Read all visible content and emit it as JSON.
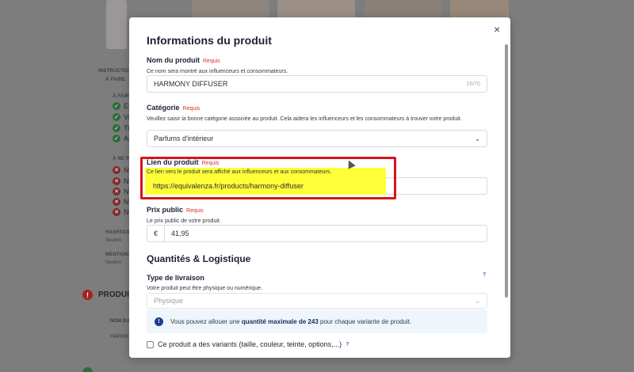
{
  "background": {
    "instructions_label": "INSTRUCTIO",
    "a_faire_label": "À FAIRE",
    "a_faire_sub": "À FAIRE",
    "do_items": [
      "Ex",
      "Vi",
      "Ti",
      "Ar"
    ],
    "ne_pas_label": "À NE P",
    "dont_items": [
      "N",
      "N",
      "N",
      "N",
      "N"
    ],
    "hashtags_label": "HASHTAG",
    "hashtags_value": "Seulem",
    "mentions_label": "MENTIONS",
    "mentions_value": "Seulem",
    "produit_heading": "PRODUIT",
    "nom_du_label": "NOM DU",
    "harmony_text": "HARMO"
  },
  "modal": {
    "title": "Informations du produit",
    "close": "×",
    "required": "Requis",
    "name": {
      "label": "Nom du produit",
      "help": "Ce nom sera montré aux influenceurs et consommateurs.",
      "value": "HARMONY DIFFUSER",
      "counter": "16/70"
    },
    "category": {
      "label": "Catégorie",
      "help": "Veuillez saisir la bonne catégorie associée au produit. Cela aidera les influenceurs et les consommateurs à trouver votre produit.",
      "value": "Parfums d'intérieur"
    },
    "link": {
      "label": "Lien du produit",
      "help": "Ce lien vers le produit sera affiché aux influenceurs et aux consommateurs.",
      "value": "https://equivalenza.fr/products/harmony-diffuser"
    },
    "price": {
      "label": "Prix public",
      "help": "Le prix public de votre produit.",
      "currency": "€",
      "value": "41,95"
    },
    "logistics": {
      "section_title": "Quantités & Logistique",
      "delivery_label": "Type de livraison",
      "delivery_help": "Votre produit peut être physique ou numérique.",
      "delivery_value": "Physique",
      "info_prefix": "Vous pouvez allouer une ",
      "info_bold": "quantité maximale de 243",
      "info_suffix": " pour chaque variante de produit.",
      "variants_label": "Ce produit a des variants (taille, couleur, teinte, options,...)"
    }
  },
  "icons": {
    "close": "close-icon",
    "chevron": "chevron-down-icon",
    "info": "info-icon",
    "help": "question-mark-icon"
  },
  "colors": {
    "required": "#e0302b",
    "highlight_box": "#d8141c",
    "highlight_fill": "#ffff38",
    "info_bg": "#eef5fb",
    "info_icon": "#1e3d8f"
  }
}
